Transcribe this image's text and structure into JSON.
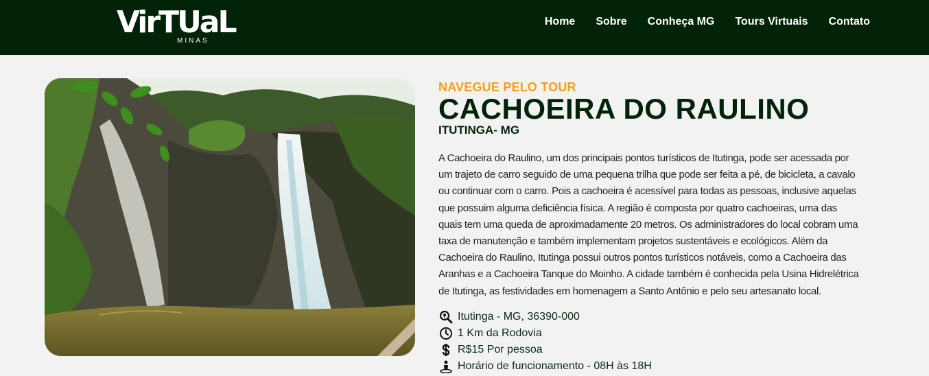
{
  "header": {
    "logo": {
      "word": "VirTUaL",
      "sub": "MINAS"
    },
    "nav": [
      {
        "label": "Home"
      },
      {
        "label": "Sobre"
      },
      {
        "label": "Conheça MG"
      },
      {
        "label": "Tours Virtuais"
      },
      {
        "label": "Contato"
      }
    ]
  },
  "hero": {
    "image_icon": "waterfall-photo"
  },
  "content": {
    "eyebrow": "NAVEGUE PELO TOUR",
    "title": "CACHOEIRA DO RAULINO",
    "subtitle": "ITUTINGA- MG",
    "description": "A Cachoeira do Raulino, um dos principais pontos turísticos de Itutinga, pode ser acessada por um trajeto de carro seguido de uma pequena trilha que pode ser feita a pé, de bicicleta, a cavalo ou continuar com o carro. Pois a cachoeira é acessível para todas as pessoas, inclusive aquelas que possuim alguma deficiência física. A região é composta por quatro cachoeiras, uma das quais tem uma queda de aproximadamente 20 metros. Os administradores do local cobram uma taxa de manutenção e também implementam projetos sustentáveis e ecológicos. Além da Cachoeira do Raulino, Itutinga possui outros pontos turísticos notáveis, como a Cachoeira das Aranhas e a Cachoeira Tanque do Moinho. A cidade também é conhecida pela Usina Hidrelétrica de Itutinga, as festividades em homenagem a Santo Antônio e pelo seu artesanato local.",
    "info": [
      {
        "icon": "search-location-icon",
        "text": "Itutinga - MG, 36390-000"
      },
      {
        "icon": "clock-icon",
        "text": "1 Km da Rodovia"
      },
      {
        "icon": "dollar-icon",
        "text": "R$15 Por pessoa"
      },
      {
        "icon": "person-pin-icon",
        "text": "Horário de funcionamento - 08H às 18H"
      }
    ]
  },
  "colors": {
    "header_bg": "#022308",
    "accent": "#f3a01a",
    "title": "#022308",
    "page_bg": "#f2f2f2"
  }
}
